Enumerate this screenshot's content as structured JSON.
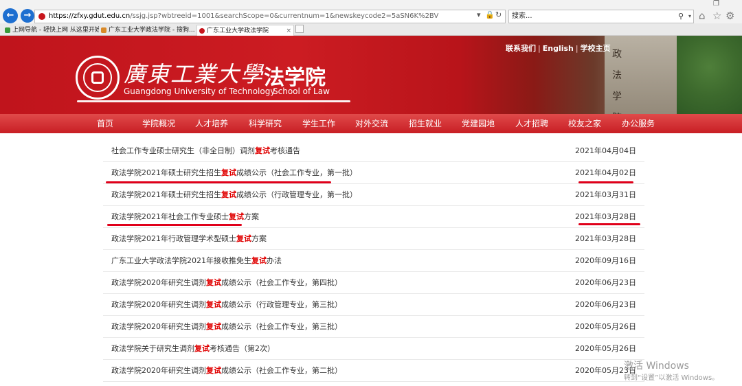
{
  "browser": {
    "url_host": "https://zfxy.gdut.edu.cn",
    "url_path": "/ssjg.jsp?wbtreeid=1001&searchScope=0&currentnum=1&newskeycode2=5aSN6K%2BV",
    "search_placeholder": "搜索...",
    "back_icon": "back-arrow-icon",
    "forward_icon": "forward-arrow-icon",
    "tabs": [
      {
        "label": "上网导航 - 轻快上网 从这里开始",
        "active": false
      },
      {
        "label": "广东工业大学政法学院 - 搜狗...",
        "active": false
      },
      {
        "label": "广东工业大学政法学院",
        "active": true
      }
    ]
  },
  "header": {
    "top_links": [
      "联系我们",
      "English",
      "学校主页"
    ],
    "university_cn": "廣東工業大學",
    "university_en": "Guangdong University of Technology",
    "school_cn": "法学院",
    "school_en": "School of Law",
    "building_sign": [
      "政",
      "法",
      "学",
      "院"
    ]
  },
  "nav": {
    "items": [
      "首页",
      "学院概况",
      "人才培养",
      "科学研究",
      "学生工作",
      "对外交流",
      "招生就业",
      "党建园地",
      "人才招聘",
      "校友之家",
      "办公服务"
    ]
  },
  "results": [
    {
      "pre": "社会工作专业硕士研究生（非全日制）调剂",
      "kw": "复试",
      "post": "考核通告",
      "date": "2021年04月04日"
    },
    {
      "pre": "政法学院2021年硕士研究生招生",
      "kw": "复试",
      "post": "成绩公示（社会工作专业，第一批）",
      "date": "2021年04月02日"
    },
    {
      "pre": "政法学院2021年硕士研究生招生",
      "kw": "复试",
      "post": "成绩公示（行政管理专业，第一批）",
      "date": "2021年03月31日"
    },
    {
      "pre": "政法学院2021年社会工作专业硕士",
      "kw": "复试",
      "post": "方案",
      "date": "2021年03月28日"
    },
    {
      "pre": "政法学院2021年行政管理学术型硕士",
      "kw": "复试",
      "post": "方案",
      "date": "2021年03月28日"
    },
    {
      "pre": "广东工业大学政法学院2021年接收推免生",
      "kw": "复试",
      "post": "办法",
      "date": "2020年09月16日"
    },
    {
      "pre": "政法学院2020年研究生调剂",
      "kw": "复试",
      "post": "成绩公示（社会工作专业，第四批）",
      "date": "2020年06月23日"
    },
    {
      "pre": "政法学院2020年研究生调剂",
      "kw": "复试",
      "post": "成绩公示（行政管理专业，第三批）",
      "date": "2020年06月23日"
    },
    {
      "pre": "政法学院2020年研究生调剂",
      "kw": "复试",
      "post": "成绩公示（社会工作专业，第三批）",
      "date": "2020年05月26日"
    },
    {
      "pre": "政法学院关于研究生调剂",
      "kw": "复试",
      "post": "考核通告（第2次）",
      "date": "2020年05月26日"
    },
    {
      "pre": "政法学院2020年研究生调剂",
      "kw": "复试",
      "post": "成绩公示（社会工作专业，第二批）",
      "date": "2020年05月23日"
    }
  ],
  "watermark": {
    "line1": "激活 Windows",
    "line2": "转到“设置”以激活 Windows。"
  },
  "colors": {
    "brand_red": "#c81e24",
    "keyword_red": "#e00000",
    "annotation_red": "#e0001a"
  }
}
